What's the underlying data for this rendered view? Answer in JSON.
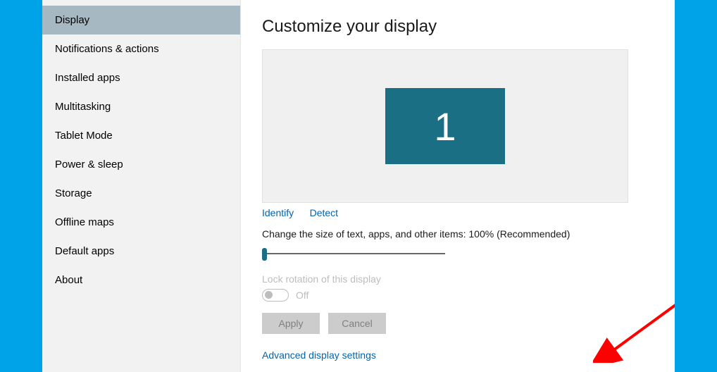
{
  "sidebar": {
    "items": [
      {
        "label": "Display",
        "selected": true
      },
      {
        "label": "Notifications & actions",
        "selected": false
      },
      {
        "label": "Installed apps",
        "selected": false
      },
      {
        "label": "Multitasking",
        "selected": false
      },
      {
        "label": "Tablet Mode",
        "selected": false
      },
      {
        "label": "Power & sleep",
        "selected": false
      },
      {
        "label": "Storage",
        "selected": false
      },
      {
        "label": "Offline maps",
        "selected": false
      },
      {
        "label": "Default apps",
        "selected": false
      },
      {
        "label": "About",
        "selected": false
      }
    ]
  },
  "main": {
    "title": "Customize your display",
    "monitor_number": "1",
    "identify_link": "Identify",
    "detect_link": "Detect",
    "size_label": "Change the size of text, apps, and other items: 100% (Recommended)",
    "lock_label": "Lock rotation of this display",
    "toggle_state": "Off",
    "apply_label": "Apply",
    "cancel_label": "Cancel",
    "advanced_link": "Advanced display settings"
  }
}
